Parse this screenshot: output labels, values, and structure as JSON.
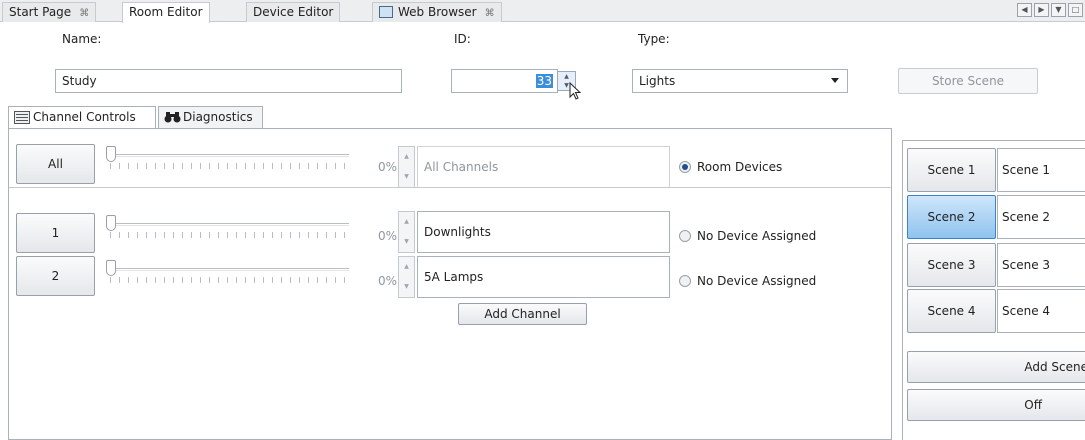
{
  "tabs": [
    {
      "label": "Start Page",
      "close": "⌘"
    },
    {
      "label": "Room Editor",
      "close": ""
    },
    {
      "label": "Device Editor",
      "close": ""
    },
    {
      "label": "Web Browser",
      "close": "⌘",
      "icon": "browser-icon"
    }
  ],
  "window_controls": [
    "◀",
    "▶",
    "▼",
    "□"
  ],
  "form": {
    "name_label": "Name:",
    "name_value": "Study",
    "id_label": "ID:",
    "id_value": "33",
    "type_label": "Type:",
    "type_value": "Lights",
    "store_scene_label": "Store Scene"
  },
  "inner_tabs": [
    {
      "label": "Channel Controls",
      "icon": "panel-icon"
    },
    {
      "label": "Diagnostics",
      "icon": "binoculars-icon"
    }
  ],
  "channels": {
    "all": {
      "button": "All",
      "level": 0,
      "percent_label": "0%",
      "name": "All Channels",
      "radio": "Room Devices",
      "radio_selected": true
    },
    "rows": [
      {
        "button": "1",
        "level": 0,
        "percent_label": "0%",
        "name": "Downlights",
        "radio": "No Device Assigned",
        "radio_selected": false
      },
      {
        "button": "2",
        "level": 0,
        "percent_label": "0%",
        "name": "5A Lamps",
        "radio": "No Device Assigned",
        "radio_selected": false
      }
    ],
    "add_channel_label": "Add Channel"
  },
  "scenes": {
    "items": [
      {
        "button": "Scene 1",
        "name": "Scene 1",
        "selected": false
      },
      {
        "button": "Scene 2",
        "name": "Scene 2",
        "selected": true
      },
      {
        "button": "Scene 3",
        "name": "Scene 3",
        "selected": false
      },
      {
        "button": "Scene 4",
        "name": "Scene 4",
        "selected": false
      }
    ],
    "add_scene_label": "Add Scene",
    "off_label": "Off"
  },
  "colors": {
    "selected_scene": "#8fc3ee",
    "id_selection": "#3d8ed8",
    "radio_selected": "#1f4f8f"
  }
}
